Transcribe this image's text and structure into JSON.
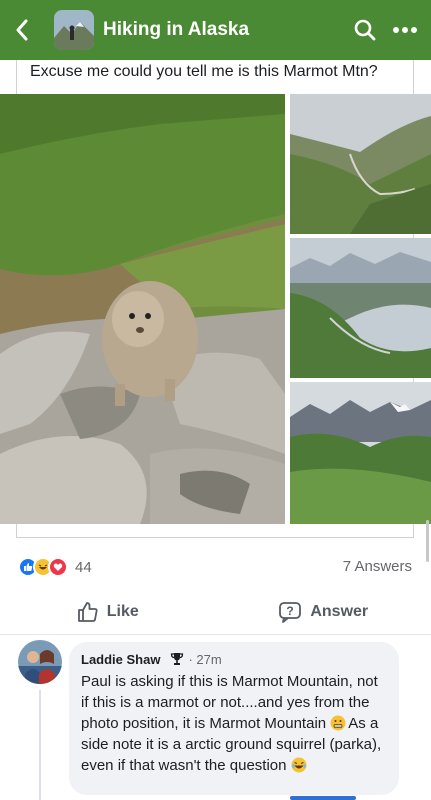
{
  "header": {
    "group_name": "Hiking in Alaska",
    "back_icon": "chevron-left-icon",
    "search_icon": "search-icon",
    "more_icon": "more-horizontal-icon",
    "color": "#4a8a34"
  },
  "post": {
    "text": "Excuse me could you tell me is this Marmot Mtn?",
    "photos": [
      "ground-squirrel-on-rocks",
      "mountain-valley-road",
      "valley-distant-peaks",
      "green-valley-snowy-peaks"
    ]
  },
  "engagement": {
    "reaction_icons": [
      "like-icon",
      "haha-icon",
      "love-icon"
    ],
    "reaction_count": "44",
    "answers_count": "7 Answers"
  },
  "actions": {
    "like_label": "Like",
    "answer_label": "Answer"
  },
  "comment": {
    "author": "Laddie Shaw",
    "badge_icon": "trophy-icon",
    "time": "· 27m",
    "body_part1": "Paul is asking if this is Marmot Mountain, not if this is a marmot or not....and yes from the photo position,  it is Marmot Mountain ",
    "body_part2": "As a side note it is a arctic ground squirrel (parka), even if that wasn't the question "
  }
}
